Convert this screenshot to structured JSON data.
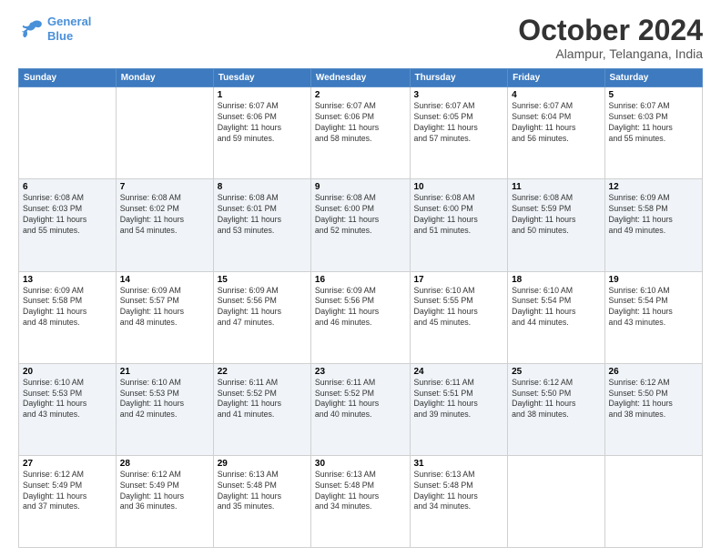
{
  "logo": {
    "line1": "General",
    "line2": "Blue"
  },
  "title": "October 2024",
  "location": "Alampur, Telangana, India",
  "days_header": [
    "Sunday",
    "Monday",
    "Tuesday",
    "Wednesday",
    "Thursday",
    "Friday",
    "Saturday"
  ],
  "weeks": [
    [
      {
        "day": "",
        "info": ""
      },
      {
        "day": "",
        "info": ""
      },
      {
        "day": "1",
        "info": "Sunrise: 6:07 AM\nSunset: 6:06 PM\nDaylight: 11 hours\nand 59 minutes."
      },
      {
        "day": "2",
        "info": "Sunrise: 6:07 AM\nSunset: 6:06 PM\nDaylight: 11 hours\nand 58 minutes."
      },
      {
        "day": "3",
        "info": "Sunrise: 6:07 AM\nSunset: 6:05 PM\nDaylight: 11 hours\nand 57 minutes."
      },
      {
        "day": "4",
        "info": "Sunrise: 6:07 AM\nSunset: 6:04 PM\nDaylight: 11 hours\nand 56 minutes."
      },
      {
        "day": "5",
        "info": "Sunrise: 6:07 AM\nSunset: 6:03 PM\nDaylight: 11 hours\nand 55 minutes."
      }
    ],
    [
      {
        "day": "6",
        "info": "Sunrise: 6:08 AM\nSunset: 6:03 PM\nDaylight: 11 hours\nand 55 minutes."
      },
      {
        "day": "7",
        "info": "Sunrise: 6:08 AM\nSunset: 6:02 PM\nDaylight: 11 hours\nand 54 minutes."
      },
      {
        "day": "8",
        "info": "Sunrise: 6:08 AM\nSunset: 6:01 PM\nDaylight: 11 hours\nand 53 minutes."
      },
      {
        "day": "9",
        "info": "Sunrise: 6:08 AM\nSunset: 6:00 PM\nDaylight: 11 hours\nand 52 minutes."
      },
      {
        "day": "10",
        "info": "Sunrise: 6:08 AM\nSunset: 6:00 PM\nDaylight: 11 hours\nand 51 minutes."
      },
      {
        "day": "11",
        "info": "Sunrise: 6:08 AM\nSunset: 5:59 PM\nDaylight: 11 hours\nand 50 minutes."
      },
      {
        "day": "12",
        "info": "Sunrise: 6:09 AM\nSunset: 5:58 PM\nDaylight: 11 hours\nand 49 minutes."
      }
    ],
    [
      {
        "day": "13",
        "info": "Sunrise: 6:09 AM\nSunset: 5:58 PM\nDaylight: 11 hours\nand 48 minutes."
      },
      {
        "day": "14",
        "info": "Sunrise: 6:09 AM\nSunset: 5:57 PM\nDaylight: 11 hours\nand 48 minutes."
      },
      {
        "day": "15",
        "info": "Sunrise: 6:09 AM\nSunset: 5:56 PM\nDaylight: 11 hours\nand 47 minutes."
      },
      {
        "day": "16",
        "info": "Sunrise: 6:09 AM\nSunset: 5:56 PM\nDaylight: 11 hours\nand 46 minutes."
      },
      {
        "day": "17",
        "info": "Sunrise: 6:10 AM\nSunset: 5:55 PM\nDaylight: 11 hours\nand 45 minutes."
      },
      {
        "day": "18",
        "info": "Sunrise: 6:10 AM\nSunset: 5:54 PM\nDaylight: 11 hours\nand 44 minutes."
      },
      {
        "day": "19",
        "info": "Sunrise: 6:10 AM\nSunset: 5:54 PM\nDaylight: 11 hours\nand 43 minutes."
      }
    ],
    [
      {
        "day": "20",
        "info": "Sunrise: 6:10 AM\nSunset: 5:53 PM\nDaylight: 11 hours\nand 43 minutes."
      },
      {
        "day": "21",
        "info": "Sunrise: 6:10 AM\nSunset: 5:53 PM\nDaylight: 11 hours\nand 42 minutes."
      },
      {
        "day": "22",
        "info": "Sunrise: 6:11 AM\nSunset: 5:52 PM\nDaylight: 11 hours\nand 41 minutes."
      },
      {
        "day": "23",
        "info": "Sunrise: 6:11 AM\nSunset: 5:52 PM\nDaylight: 11 hours\nand 40 minutes."
      },
      {
        "day": "24",
        "info": "Sunrise: 6:11 AM\nSunset: 5:51 PM\nDaylight: 11 hours\nand 39 minutes."
      },
      {
        "day": "25",
        "info": "Sunrise: 6:12 AM\nSunset: 5:50 PM\nDaylight: 11 hours\nand 38 minutes."
      },
      {
        "day": "26",
        "info": "Sunrise: 6:12 AM\nSunset: 5:50 PM\nDaylight: 11 hours\nand 38 minutes."
      }
    ],
    [
      {
        "day": "27",
        "info": "Sunrise: 6:12 AM\nSunset: 5:49 PM\nDaylight: 11 hours\nand 37 minutes."
      },
      {
        "day": "28",
        "info": "Sunrise: 6:12 AM\nSunset: 5:49 PM\nDaylight: 11 hours\nand 36 minutes."
      },
      {
        "day": "29",
        "info": "Sunrise: 6:13 AM\nSunset: 5:48 PM\nDaylight: 11 hours\nand 35 minutes."
      },
      {
        "day": "30",
        "info": "Sunrise: 6:13 AM\nSunset: 5:48 PM\nDaylight: 11 hours\nand 34 minutes."
      },
      {
        "day": "31",
        "info": "Sunrise: 6:13 AM\nSunset: 5:48 PM\nDaylight: 11 hours\nand 34 minutes."
      },
      {
        "day": "",
        "info": ""
      },
      {
        "day": "",
        "info": ""
      }
    ]
  ]
}
